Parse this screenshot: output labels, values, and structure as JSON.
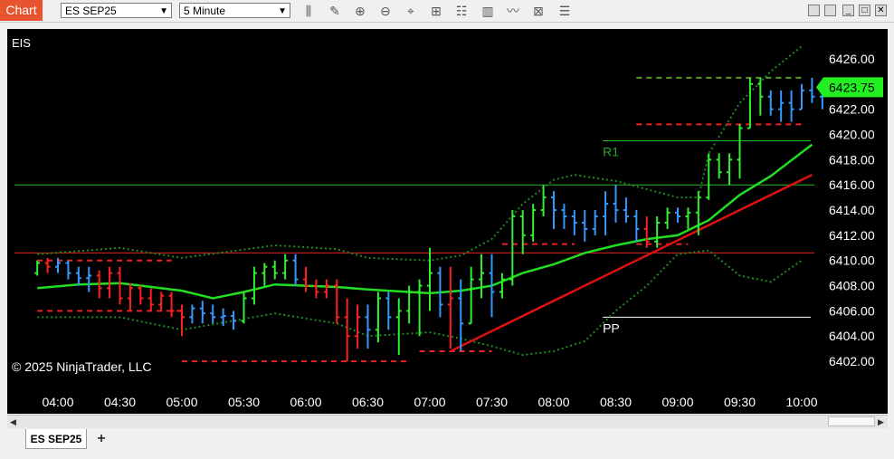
{
  "toolbar": {
    "chart_tab": "Chart",
    "instrument_select": "ES SEP25",
    "interval_select": "5 Minute",
    "tools": [
      "bars-type-icon",
      "pencil-icon",
      "zoom-in-icon",
      "zoom-out-icon",
      "crosshair-icon",
      "data-box-icon",
      "strategies-icon",
      "indicators-icon",
      "drawing-icon",
      "properties-icon",
      "menu-icon"
    ]
  },
  "window_buttons": [
    "minimize",
    "restore",
    "maximize",
    "close"
  ],
  "tabs": {
    "instrument": "ES SEP25",
    "add": "+"
  },
  "colors": {
    "up": "#33ee33",
    "down": "#ff2020",
    "neutral": "#3399ff",
    "sma": "#22dd22",
    "trend": "#dd1111",
    "price_tag": "#22ee22"
  },
  "chart_data": {
    "type": "candlestick",
    "label_top_left": "EIS",
    "copyright": "© 2025 NinjaTrader, LLC",
    "current_price": "6423.75",
    "y_ticks": [
      "6426.00",
      "6424.00",
      "6422.00",
      "6420.00",
      "6418.00",
      "6416.00",
      "6414.00",
      "6412.00",
      "6410.00",
      "6408.00",
      "6406.00",
      "6404.00",
      "6402.00"
    ],
    "ylim": [
      6401,
      6427.5
    ],
    "x_ticks": [
      "04:00",
      "04:30",
      "05:00",
      "05:30",
      "06:00",
      "06:30",
      "07:00",
      "07:30",
      "08:00",
      "08:30",
      "09:00",
      "09:30",
      "10:00"
    ],
    "pivots": [
      {
        "label": "R1",
        "value": 6419.5,
        "start_time": "08:25"
      },
      {
        "label": "PP",
        "value": 6405.5,
        "start_time": "08:25"
      }
    ],
    "horizontal_levels": [
      {
        "value": 6416.0,
        "color": "green"
      },
      {
        "value": 6410.6,
        "color": "red"
      }
    ],
    "trend_line": {
      "start": [
        "07:10",
        6402.8
      ],
      "end": [
        "10:05",
        6416.8
      ]
    },
    "sma_line": [
      [
        "03:50",
        6407.8
      ],
      [
        "04:10",
        6408.1
      ],
      [
        "04:30",
        6408.2
      ],
      [
        "05:00",
        6407.6
      ],
      [
        "05:15",
        6407.0
      ],
      [
        "05:30",
        6407.5
      ],
      [
        "05:45",
        6408.1
      ],
      [
        "06:15",
        6407.9
      ],
      [
        "06:30",
        6407.7
      ],
      [
        "07:00",
        6407.4
      ],
      [
        "07:15",
        6407.6
      ],
      [
        "07:30",
        6408.0
      ],
      [
        "07:45",
        6409.0
      ],
      [
        "08:00",
        6409.7
      ],
      [
        "08:15",
        6410.6
      ],
      [
        "08:30",
        6411.2
      ],
      [
        "08:45",
        6411.7
      ],
      [
        "09:00",
        6412.0
      ],
      [
        "09:15",
        6413.2
      ],
      [
        "09:30",
        6415.2
      ],
      [
        "09:45",
        6416.7
      ],
      [
        "10:05",
        6419.2
      ]
    ],
    "bollinger_upper": [
      [
        "03:50",
        6410.5
      ],
      [
        "04:30",
        6411.0
      ],
      [
        "05:00",
        6410.2
      ],
      [
        "05:45",
        6411.2
      ],
      [
        "06:15",
        6410.9
      ],
      [
        "06:30",
        6410.2
      ],
      [
        "07:00",
        6410.0
      ],
      [
        "07:15",
        6410.4
      ],
      [
        "07:30",
        6411.7
      ],
      [
        "07:45",
        6414.5
      ],
      [
        "08:00",
        6416.4
      ],
      [
        "08:10",
        6416.8
      ],
      [
        "08:30",
        6416.3
      ],
      [
        "09:00",
        6415.0
      ],
      [
        "09:10",
        6415.0
      ],
      [
        "09:15",
        6418.5
      ],
      [
        "09:30",
        6422.5
      ],
      [
        "09:45",
        6425.0
      ],
      [
        "10:00",
        6427.0
      ]
    ],
    "bollinger_lower": [
      [
        "03:50",
        6405.5
      ],
      [
        "04:30",
        6405.5
      ],
      [
        "05:00",
        6404.5
      ],
      [
        "05:45",
        6405.8
      ],
      [
        "06:15",
        6405.0
      ],
      [
        "06:30",
        6404.0
      ],
      [
        "07:00",
        6404.3
      ],
      [
        "07:15",
        6403.8
      ],
      [
        "07:30",
        6403.2
      ],
      [
        "07:45",
        6402.5
      ],
      [
        "08:00",
        6402.8
      ],
      [
        "08:15",
        6403.6
      ],
      [
        "08:30",
        6406.0
      ],
      [
        "08:45",
        6408.0
      ],
      [
        "09:00",
        6410.5
      ],
      [
        "09:15",
        6410.8
      ],
      [
        "09:30",
        6408.8
      ],
      [
        "09:45",
        6408.3
      ],
      [
        "10:00",
        6410.0
      ]
    ],
    "support_levels": [
      {
        "value": 6410.0,
        "from": "03:50",
        "to": "04:55"
      },
      {
        "value": 6406.0,
        "from": "03:50",
        "to": "05:00"
      },
      {
        "value": 6402.0,
        "from": "05:00",
        "to": "06:50"
      },
      {
        "value": 6402.8,
        "from": "06:55",
        "to": "07:30"
      },
      {
        "value": 6411.3,
        "from": "07:35",
        "to": "08:10"
      },
      {
        "value": 6411.3,
        "from": "08:40",
        "to": "09:05"
      },
      {
        "value": 6424.5,
        "from": "08:40",
        "to": "10:00"
      },
      {
        "value": 6420.8,
        "from": "08:40",
        "to": "10:00"
      }
    ],
    "candles": [
      {
        "t": "03:50",
        "o": 6409.0,
        "h": 6410.0,
        "l": 6408.8,
        "c": 6409.8,
        "d": "up"
      },
      {
        "t": "03:55",
        "o": 6409.8,
        "h": 6410.2,
        "l": 6409.0,
        "c": 6409.5,
        "d": "down"
      },
      {
        "t": "04:00",
        "o": 6409.5,
        "h": 6410.2,
        "l": 6409.0,
        "c": 6409.8,
        "d": "neutral"
      },
      {
        "t": "04:05",
        "o": 6409.8,
        "h": 6410.0,
        "l": 6408.5,
        "c": 6409.0,
        "d": "neutral"
      },
      {
        "t": "04:10",
        "o": 6409.0,
        "h": 6409.5,
        "l": 6408.0,
        "c": 6408.6,
        "d": "neutral"
      },
      {
        "t": "04:15",
        "o": 6408.6,
        "h": 6409.5,
        "l": 6407.5,
        "c": 6408.8,
        "d": "neutral"
      },
      {
        "t": "04:20",
        "o": 6408.8,
        "h": 6409.2,
        "l": 6407.0,
        "c": 6407.8,
        "d": "down"
      },
      {
        "t": "04:25",
        "o": 6407.8,
        "h": 6409.5,
        "l": 6407.0,
        "c": 6409.0,
        "d": "down"
      },
      {
        "t": "04:30",
        "o": 6409.0,
        "h": 6409.5,
        "l": 6406.5,
        "c": 6407.0,
        "d": "down"
      },
      {
        "t": "04:35",
        "o": 6407.0,
        "h": 6408.2,
        "l": 6406.0,
        "c": 6407.8,
        "d": "down"
      },
      {
        "t": "04:40",
        "o": 6407.8,
        "h": 6408.0,
        "l": 6406.5,
        "c": 6407.0,
        "d": "down"
      },
      {
        "t": "04:45",
        "o": 6407.0,
        "h": 6407.8,
        "l": 6406.0,
        "c": 6406.5,
        "d": "down"
      },
      {
        "t": "04:50",
        "o": 6406.5,
        "h": 6407.5,
        "l": 6406.0,
        "c": 6407.2,
        "d": "down"
      },
      {
        "t": "04:55",
        "o": 6407.2,
        "h": 6407.5,
        "l": 6405.5,
        "c": 6406.0,
        "d": "down"
      },
      {
        "t": "05:00",
        "o": 6406.0,
        "h": 6406.5,
        "l": 6404.0,
        "c": 6405.5,
        "d": "down"
      },
      {
        "t": "05:05",
        "o": 6405.5,
        "h": 6406.5,
        "l": 6405.0,
        "c": 6406.2,
        "d": "neutral"
      },
      {
        "t": "05:10",
        "o": 6406.2,
        "h": 6406.8,
        "l": 6405.0,
        "c": 6405.8,
        "d": "neutral"
      },
      {
        "t": "05:15",
        "o": 6405.8,
        "h": 6406.5,
        "l": 6405.0,
        "c": 6405.5,
        "d": "neutral"
      },
      {
        "t": "05:20",
        "o": 6405.5,
        "h": 6406.2,
        "l": 6404.8,
        "c": 6405.6,
        "d": "neutral"
      },
      {
        "t": "05:25",
        "o": 6405.6,
        "h": 6406.0,
        "l": 6404.5,
        "c": 6405.2,
        "d": "neutral"
      },
      {
        "t": "05:30",
        "o": 6405.2,
        "h": 6407.5,
        "l": 6405.0,
        "c": 6407.0,
        "d": "up"
      },
      {
        "t": "05:35",
        "o": 6407.0,
        "h": 6409.5,
        "l": 6406.5,
        "c": 6409.0,
        "d": "up"
      },
      {
        "t": "05:40",
        "o": 6409.0,
        "h": 6409.8,
        "l": 6408.0,
        "c": 6409.5,
        "d": "up"
      },
      {
        "t": "05:45",
        "o": 6409.5,
        "h": 6410.0,
        "l": 6408.5,
        "c": 6409.0,
        "d": "up"
      },
      {
        "t": "05:50",
        "o": 6409.0,
        "h": 6410.5,
        "l": 6408.5,
        "c": 6410.0,
        "d": "up"
      },
      {
        "t": "05:55",
        "o": 6410.0,
        "h": 6410.5,
        "l": 6408.0,
        "c": 6408.5,
        "d": "neutral"
      },
      {
        "t": "06:00",
        "o": 6408.5,
        "h": 6409.5,
        "l": 6407.5,
        "c": 6408.0,
        "d": "down"
      },
      {
        "t": "06:05",
        "o": 6408.0,
        "h": 6408.5,
        "l": 6407.0,
        "c": 6407.5,
        "d": "down"
      },
      {
        "t": "06:10",
        "o": 6407.5,
        "h": 6408.5,
        "l": 6407.0,
        "c": 6408.0,
        "d": "down"
      },
      {
        "t": "06:15",
        "o": 6408.0,
        "h": 6408.5,
        "l": 6405.0,
        "c": 6405.5,
        "d": "down"
      },
      {
        "t": "06:20",
        "o": 6405.5,
        "h": 6407.0,
        "l": 6402.0,
        "c": 6404.0,
        "d": "down"
      },
      {
        "t": "06:25",
        "o": 6404.0,
        "h": 6406.5,
        "l": 6403.0,
        "c": 6405.5,
        "d": "down"
      },
      {
        "t": "06:30",
        "o": 6405.5,
        "h": 6406.5,
        "l": 6403.0,
        "c": 6404.5,
        "d": "neutral"
      },
      {
        "t": "06:35",
        "o": 6404.5,
        "h": 6407.5,
        "l": 6403.5,
        "c": 6407.0,
        "d": "up"
      },
      {
        "t": "06:40",
        "o": 6407.0,
        "h": 6407.5,
        "l": 6404.5,
        "c": 6405.5,
        "d": "neutral"
      },
      {
        "t": "06:45",
        "o": 6405.5,
        "h": 6407.0,
        "l": 6402.5,
        "c": 6406.0,
        "d": "up"
      },
      {
        "t": "06:50",
        "o": 6406.0,
        "h": 6408.0,
        "l": 6405.0,
        "c": 6407.5,
        "d": "up"
      },
      {
        "t": "06:55",
        "o": 6407.5,
        "h": 6408.5,
        "l": 6404.0,
        "c": 6408.0,
        "d": "up"
      },
      {
        "t": "07:00",
        "o": 6408.0,
        "h": 6411.0,
        "l": 6406.0,
        "c": 6409.0,
        "d": "up"
      },
      {
        "t": "07:05",
        "o": 6409.0,
        "h": 6409.5,
        "l": 6405.5,
        "c": 6406.5,
        "d": "neutral"
      },
      {
        "t": "07:10",
        "o": 6406.5,
        "h": 6409.5,
        "l": 6403.0,
        "c": 6407.0,
        "d": "down"
      },
      {
        "t": "07:15",
        "o": 6407.0,
        "h": 6408.5,
        "l": 6402.8,
        "c": 6405.0,
        "d": "neutral"
      },
      {
        "t": "07:20",
        "o": 6405.0,
        "h": 6409.5,
        "l": 6405.0,
        "c": 6408.5,
        "d": "up"
      },
      {
        "t": "07:25",
        "o": 6408.5,
        "h": 6410.5,
        "l": 6407.0,
        "c": 6409.0,
        "d": "up"
      },
      {
        "t": "07:30",
        "o": 6409.0,
        "h": 6410.5,
        "l": 6405.5,
        "c": 6407.5,
        "d": "neutral"
      },
      {
        "t": "07:35",
        "o": 6407.5,
        "h": 6409.0,
        "l": 6407.0,
        "c": 6408.5,
        "d": "up"
      },
      {
        "t": "07:40",
        "o": 6408.5,
        "h": 6414.0,
        "l": 6408.0,
        "c": 6413.5,
        "d": "up"
      },
      {
        "t": "07:45",
        "o": 6413.5,
        "h": 6414.0,
        "l": 6410.5,
        "c": 6412.0,
        "d": "up"
      },
      {
        "t": "07:50",
        "o": 6412.0,
        "h": 6414.5,
        "l": 6411.5,
        "c": 6414.0,
        "d": "up"
      },
      {
        "t": "07:55",
        "o": 6414.0,
        "h": 6416.0,
        "l": 6413.5,
        "c": 6415.0,
        "d": "up"
      },
      {
        "t": "08:00",
        "o": 6415.0,
        "h": 6415.5,
        "l": 6412.5,
        "c": 6414.0,
        "d": "neutral"
      },
      {
        "t": "08:05",
        "o": 6414.0,
        "h": 6414.5,
        "l": 6412.5,
        "c": 6413.5,
        "d": "neutral"
      },
      {
        "t": "08:10",
        "o": 6413.5,
        "h": 6414.0,
        "l": 6412.0,
        "c": 6413.0,
        "d": "neutral"
      },
      {
        "t": "08:15",
        "o": 6413.0,
        "h": 6414.0,
        "l": 6411.5,
        "c": 6412.5,
        "d": "neutral"
      },
      {
        "t": "08:20",
        "o": 6412.5,
        "h": 6414.0,
        "l": 6412.0,
        "c": 6413.5,
        "d": "neutral"
      },
      {
        "t": "08:25",
        "o": 6413.5,
        "h": 6415.5,
        "l": 6412.0,
        "c": 6414.5,
        "d": "neutral"
      },
      {
        "t": "08:30",
        "o": 6414.5,
        "h": 6416.0,
        "l": 6413.0,
        "c": 6414.0,
        "d": "neutral"
      },
      {
        "t": "08:35",
        "o": 6414.0,
        "h": 6415.0,
        "l": 6413.0,
        "c": 6413.5,
        "d": "neutral"
      },
      {
        "t": "08:40",
        "o": 6413.5,
        "h": 6414.0,
        "l": 6411.5,
        "c": 6412.5,
        "d": "neutral"
      },
      {
        "t": "08:45",
        "o": 6412.5,
        "h": 6413.5,
        "l": 6411.0,
        "c": 6411.5,
        "d": "down"
      },
      {
        "t": "08:50",
        "o": 6411.5,
        "h": 6413.5,
        "l": 6411.0,
        "c": 6413.0,
        "d": "up"
      },
      {
        "t": "08:55",
        "o": 6413.0,
        "h": 6414.2,
        "l": 6412.5,
        "c": 6413.8,
        "d": "up"
      },
      {
        "t": "09:00",
        "o": 6413.8,
        "h": 6414.2,
        "l": 6413.0,
        "c": 6413.5,
        "d": "neutral"
      },
      {
        "t": "09:05",
        "o": 6413.5,
        "h": 6414.2,
        "l": 6412.5,
        "c": 6413.8,
        "d": "up"
      },
      {
        "t": "09:10",
        "o": 6413.8,
        "h": 6415.5,
        "l": 6412.0,
        "c": 6415.0,
        "d": "up"
      },
      {
        "t": "09:15",
        "o": 6415.0,
        "h": 6418.5,
        "l": 6414.8,
        "c": 6418.0,
        "d": "up"
      },
      {
        "t": "09:20",
        "o": 6418.0,
        "h": 6418.5,
        "l": 6416.5,
        "c": 6417.0,
        "d": "up"
      },
      {
        "t": "09:25",
        "o": 6417.0,
        "h": 6418.5,
        "l": 6416.0,
        "c": 6418.0,
        "d": "up"
      },
      {
        "t": "09:30",
        "o": 6418.0,
        "h": 6420.8,
        "l": 6416.5,
        "c": 6420.5,
        "d": "up"
      },
      {
        "t": "09:35",
        "o": 6420.5,
        "h": 6424.5,
        "l": 6420.5,
        "c": 6424.0,
        "d": "up"
      },
      {
        "t": "09:40",
        "o": 6424.0,
        "h": 6424.5,
        "l": 6421.5,
        "c": 6423.0,
        "d": "up"
      },
      {
        "t": "09:45",
        "o": 6423.0,
        "h": 6423.5,
        "l": 6421.5,
        "c": 6422.0,
        "d": "neutral"
      },
      {
        "t": "09:50",
        "o": 6422.0,
        "h": 6423.5,
        "l": 6421.0,
        "c": 6422.5,
        "d": "neutral"
      },
      {
        "t": "09:55",
        "o": 6422.5,
        "h": 6423.5,
        "l": 6421.0,
        "c": 6422.0,
        "d": "neutral"
      },
      {
        "t": "10:00",
        "o": 6422.0,
        "h": 6424.0,
        "l": 6422.0,
        "c": 6423.5,
        "d": "neutral"
      },
      {
        "t": "10:05",
        "o": 6423.5,
        "h": 6424.5,
        "l": 6422.5,
        "c": 6423.0,
        "d": "neutral"
      },
      {
        "t": "10:10",
        "o": 6423.0,
        "h": 6424.0,
        "l": 6422.0,
        "c": 6423.75,
        "d": "neutral"
      }
    ]
  }
}
